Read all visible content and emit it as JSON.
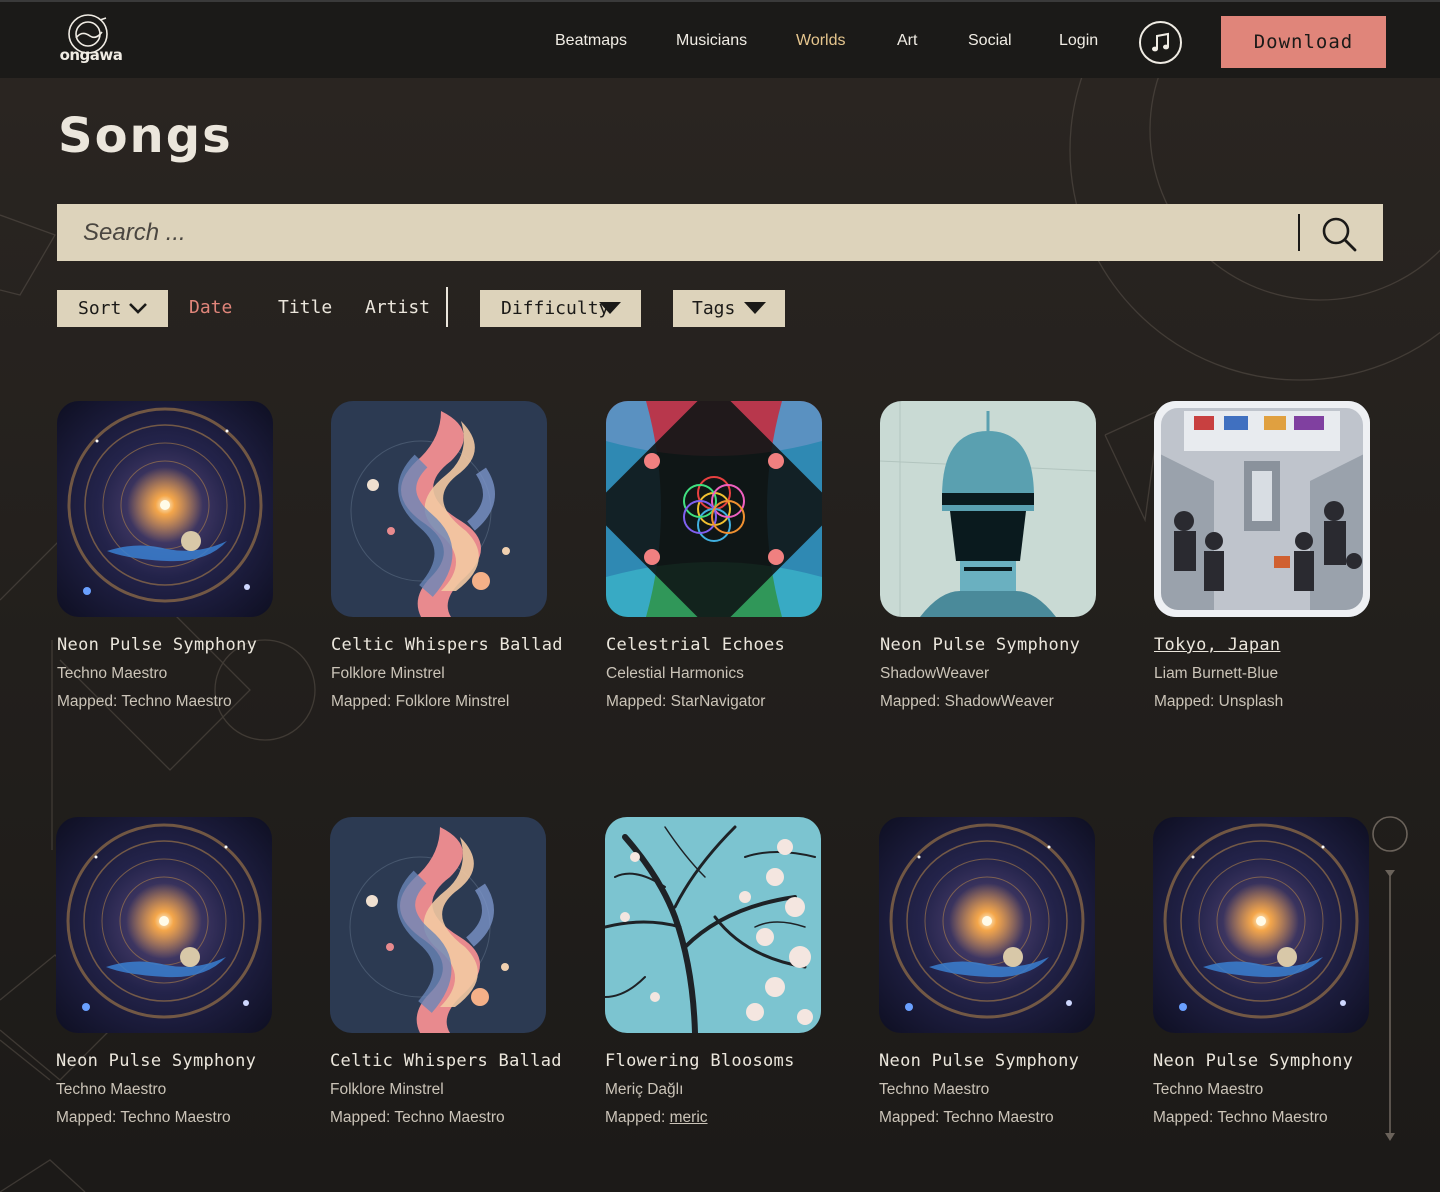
{
  "brand": {
    "logo_text": "ongawa"
  },
  "nav": {
    "links": [
      {
        "label": "Beatmaps",
        "active": false
      },
      {
        "label": "Musicians",
        "active": false
      },
      {
        "label": "Worlds",
        "active": true
      },
      {
        "label": "Art",
        "active": false
      },
      {
        "label": "Social",
        "active": false
      },
      {
        "label": "Login",
        "active": false
      }
    ],
    "music_icon": "music-note-icon",
    "download_label": "Download"
  },
  "page": {
    "title": "Songs"
  },
  "search": {
    "placeholder": "Search ...",
    "value": "",
    "icon": "search-icon"
  },
  "filters": {
    "sort_label": "Sort",
    "sort_options": [
      {
        "label": "Date",
        "active": true
      },
      {
        "label": "Title",
        "active": false
      },
      {
        "label": "Artist",
        "active": false
      }
    ],
    "difficulty_label": "Difficulty",
    "tags_label": "Tags"
  },
  "colors": {
    "accent": "#e0857a",
    "nav_active": "#e6c68e",
    "search_bg": "#ddd3bb",
    "nav_bg": "#1b1a18"
  },
  "songs": [
    {
      "title": "Neon Pulse Symphony",
      "artist": "Techno Maestro",
      "mapped_prefix": "Mapped: ",
      "mapper": "Techno Maestro",
      "mapper_link": false,
      "title_link": false,
      "cover": "cosmic-portal"
    },
    {
      "title": "Celtic Whispers Ballad",
      "artist": "Folklore Minstrel",
      "mapped_prefix": "Mapped: ",
      "mapper": "Folklore Minstrel",
      "mapper_link": false,
      "title_link": false,
      "cover": "swirl-waves"
    },
    {
      "title": "Celestrial Echoes",
      "artist": "Celestial Harmonics",
      "mapped_prefix": "Mapped: ",
      "mapper": "StarNavigator",
      "mapper_link": false,
      "title_link": false,
      "cover": "kaleidoscope"
    },
    {
      "title": "Neon Pulse Symphony",
      "artist": "ShadowWeaver",
      "mapped_prefix": "Mapped: ",
      "mapper": "ShadowWeaver",
      "mapper_link": false,
      "title_link": false,
      "cover": "robot-head"
    },
    {
      "title": "Tokyo, Japan",
      "artist": "Liam Burnett-Blue",
      "mapped_prefix": "Mapped: ",
      "mapper": "Unsplash",
      "mapper_link": false,
      "title_link": true,
      "cover": "train-interior"
    },
    {
      "title": "Neon Pulse Symphony",
      "artist": "Techno Maestro",
      "mapped_prefix": "Mapped: ",
      "mapper": "Techno Maestro",
      "mapper_link": false,
      "title_link": false,
      "cover": "cosmic-portal"
    },
    {
      "title": "Celtic Whispers Ballad",
      "artist": "Folklore Minstrel",
      "mapped_prefix": "Mapped: ",
      "mapper": "Techno Maestro",
      "mapper_link": false,
      "title_link": false,
      "cover": "swirl-waves"
    },
    {
      "title": "Flowering Bloosoms",
      "artist": "Meriç Dağlı",
      "mapped_prefix": "Mapped: ",
      "mapper": "meric",
      "mapper_link": true,
      "title_link": false,
      "cover": "blossom-tree"
    },
    {
      "title": "Neon Pulse Symphony",
      "artist": "Techno Maestro",
      "mapped_prefix": "Mapped: ",
      "mapper": "Techno Maestro",
      "mapper_link": false,
      "title_link": false,
      "cover": "cosmic-portal"
    },
    {
      "title": "Neon Pulse Symphony",
      "artist": "Techno Maestro",
      "mapped_prefix": "Mapped: ",
      "mapper": "Techno Maestro",
      "mapper_link": false,
      "title_link": false,
      "cover": "cosmic-portal"
    }
  ]
}
